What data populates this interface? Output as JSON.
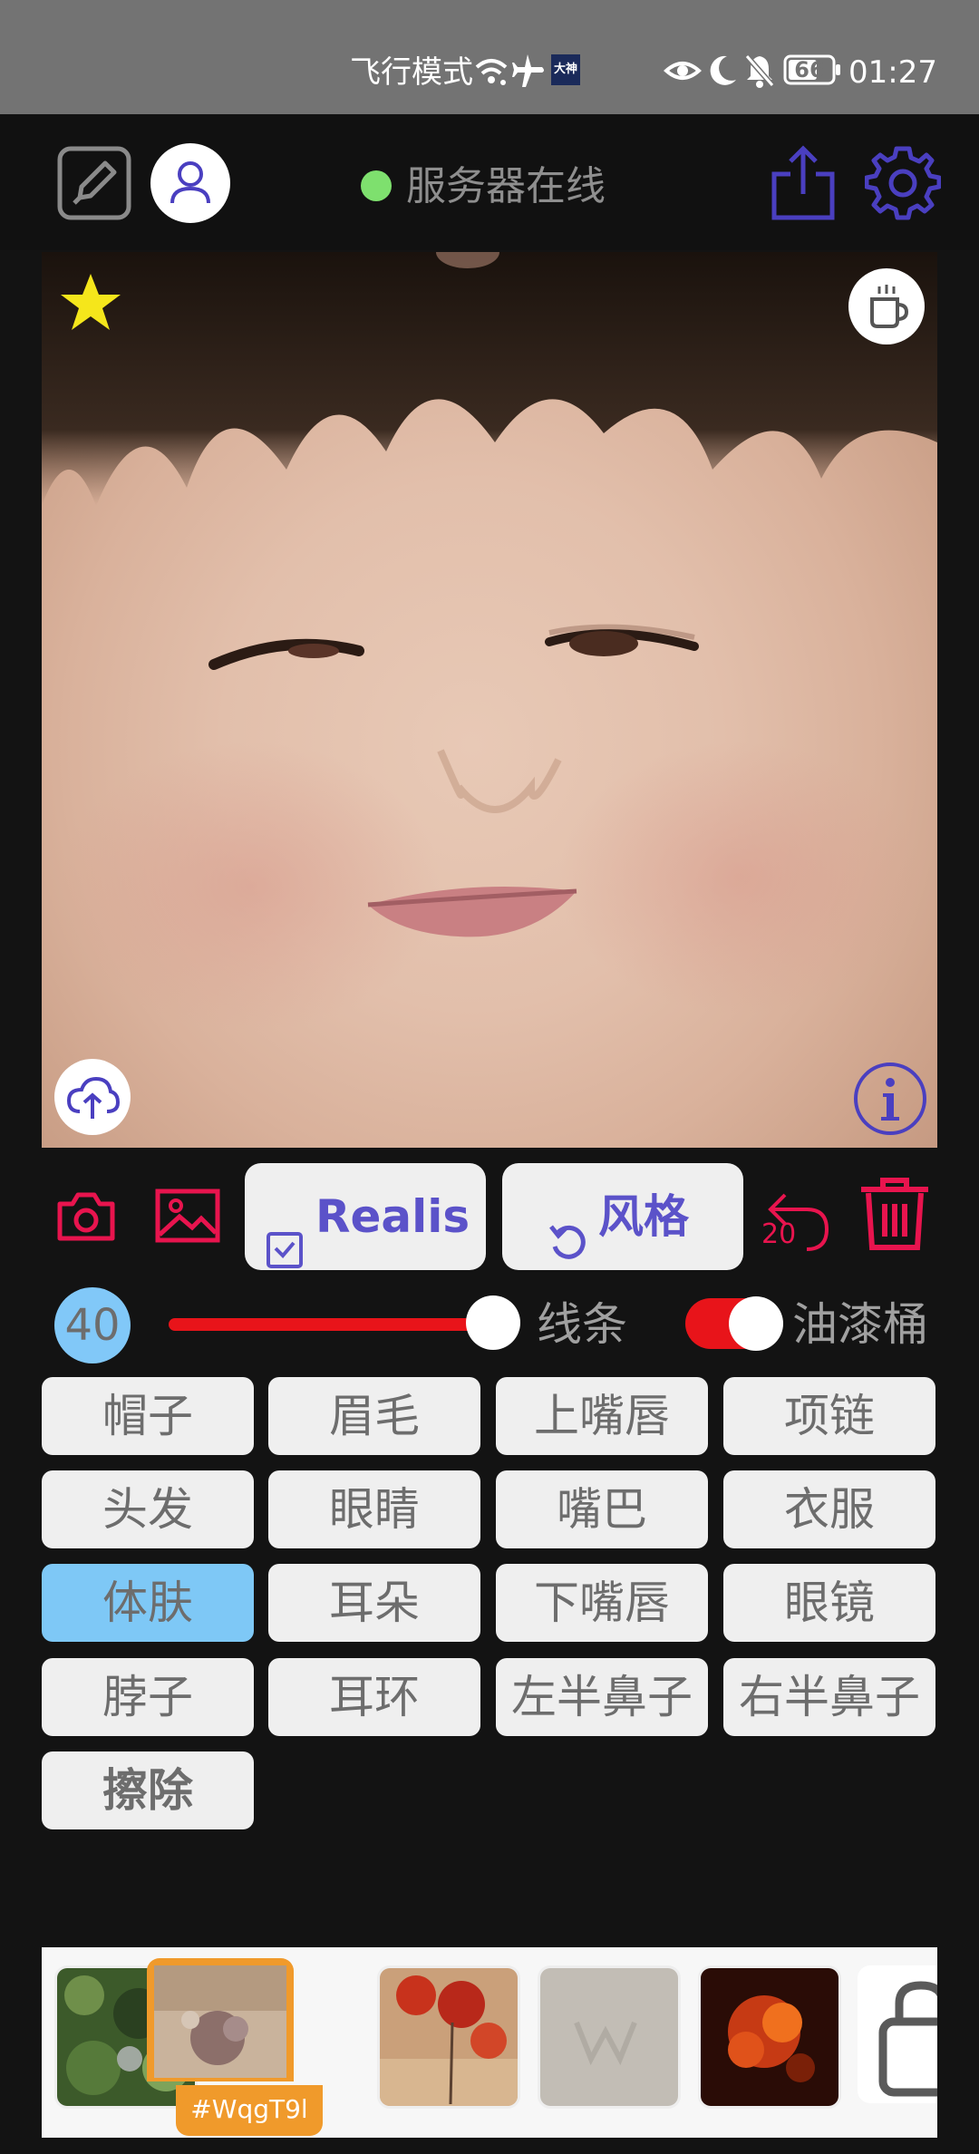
{
  "status_bar": {
    "airplane_mode_text": "飞行模式",
    "app_badge_text": "大神",
    "battery_level": "66",
    "time": "01:27"
  },
  "header": {
    "server_status_label": "服务器在线",
    "server_status_color": "#7ee06e",
    "icons": [
      "edit-icon",
      "user-icon",
      "share-icon",
      "settings-icon"
    ]
  },
  "canvas": {
    "icons": [
      "star-icon",
      "coffee-icon",
      "upload-cloud-icon",
      "info-icon"
    ]
  },
  "toolbar": {
    "realis_label": "Realis",
    "style_label": "风格",
    "undo_count": "20",
    "icons": [
      "camera-icon",
      "image-icon",
      "checkbox-icon",
      "rotate-icon",
      "undo-icon",
      "trash-icon"
    ]
  },
  "brush": {
    "size": "40",
    "slider_level": 0.87,
    "line_label": "线条",
    "bucket_label": "油漆桶",
    "bucket_enabled": true
  },
  "parts": [
    {
      "label": "帽子",
      "selected": false
    },
    {
      "label": "眉毛",
      "selected": false
    },
    {
      "label": "上嘴唇",
      "selected": false
    },
    {
      "label": "项链",
      "selected": false
    },
    {
      "label": "头发",
      "selected": false
    },
    {
      "label": "眼睛",
      "selected": false
    },
    {
      "label": "嘴巴",
      "selected": false
    },
    {
      "label": "衣服",
      "selected": false
    },
    {
      "label": "体肤",
      "selected": true
    },
    {
      "label": "耳朵",
      "selected": false
    },
    {
      "label": "下嘴唇",
      "selected": false
    },
    {
      "label": "眼镜",
      "selected": false
    },
    {
      "label": "脖子",
      "selected": false
    },
    {
      "label": "耳环",
      "selected": false
    },
    {
      "label": "左半鼻子",
      "selected": false
    },
    {
      "label": "右半鼻子",
      "selected": false
    },
    {
      "label": "擦除",
      "selected": false
    }
  ],
  "thumbnails": {
    "selected_tag": "#WqgT9l",
    "selected_index": 1,
    "locked_icon": "lock-icon"
  },
  "colors": {
    "accent": "#5b52c9",
    "danger": "#e8144e",
    "selected_part": "#7ec8f6",
    "thumb_tag": "#f09a2b"
  }
}
